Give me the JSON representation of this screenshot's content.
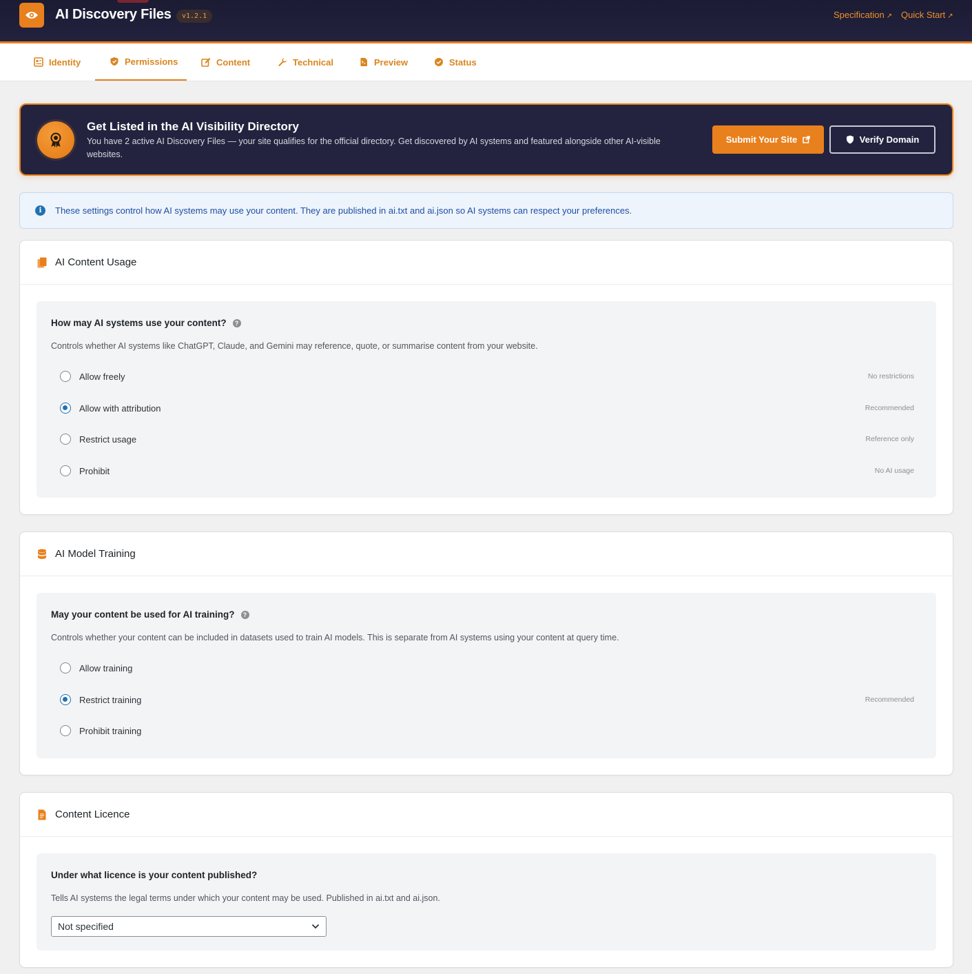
{
  "header": {
    "title": "AI Discovery Files",
    "version": "v1.2.1",
    "links": {
      "specification": "Specification",
      "quick_start": "Quick Start",
      "arrow": "↗"
    }
  },
  "tabs": [
    {
      "label": "Identity",
      "icon": "id-card-icon",
      "active": false
    },
    {
      "label": "Permissions",
      "icon": "shield-icon",
      "active": true
    },
    {
      "label": "Content",
      "icon": "edit-icon",
      "active": false
    },
    {
      "label": "Technical",
      "icon": "wrench-icon",
      "active": false
    },
    {
      "label": "Preview",
      "icon": "document-icon",
      "active": false
    },
    {
      "label": "Status",
      "icon": "check-circle-icon",
      "active": false
    }
  ],
  "banner": {
    "title": "Get Listed in the AI Visibility Directory",
    "text": "You have 2 active AI Discovery Files — your site qualifies for the official directory. Get discovered by AI systems and featured alongside other AI-visible websites.",
    "submit_label": "Submit Your Site",
    "verify_label": "Verify Domain"
  },
  "notice": {
    "text": "These settings control how AI systems may use your content. They are published in ai.txt and ai.json so AI systems can respect your preferences."
  },
  "content_usage": {
    "title": "AI Content Usage",
    "question": "How may AI systems use your content?",
    "description": "Controls whether AI systems like ChatGPT, Claude, and Gemini may reference, quote, or summarise content from your website.",
    "options": [
      {
        "label": "Allow freely",
        "tag": "No restrictions",
        "selected": false
      },
      {
        "label": "Allow with attribution",
        "tag": "Recommended",
        "selected": true
      },
      {
        "label": "Restrict usage",
        "tag": "Reference only",
        "selected": false
      },
      {
        "label": "Prohibit",
        "tag": "No AI usage",
        "selected": false
      }
    ]
  },
  "model_training": {
    "title": "AI Model Training",
    "question": "May your content be used for AI training?",
    "description": "Controls whether your content can be included in datasets used to train AI models. This is separate from AI systems using your content at query time.",
    "options": [
      {
        "label": "Allow training",
        "tag": "",
        "selected": false
      },
      {
        "label": "Restrict training",
        "tag": "Recommended",
        "selected": true
      },
      {
        "label": "Prohibit training",
        "tag": "",
        "selected": false
      }
    ]
  },
  "licence": {
    "title": "Content Licence",
    "question": "Under what licence is your content published?",
    "description": "Tells AI systems the legal terms under which your content may be used. Published in ai.txt and ai.json.",
    "selected": "Not specified"
  },
  "colors": {
    "accent": "#e8801d",
    "header_bg": "#1e1e38",
    "radio_selected": "#2271b1"
  }
}
